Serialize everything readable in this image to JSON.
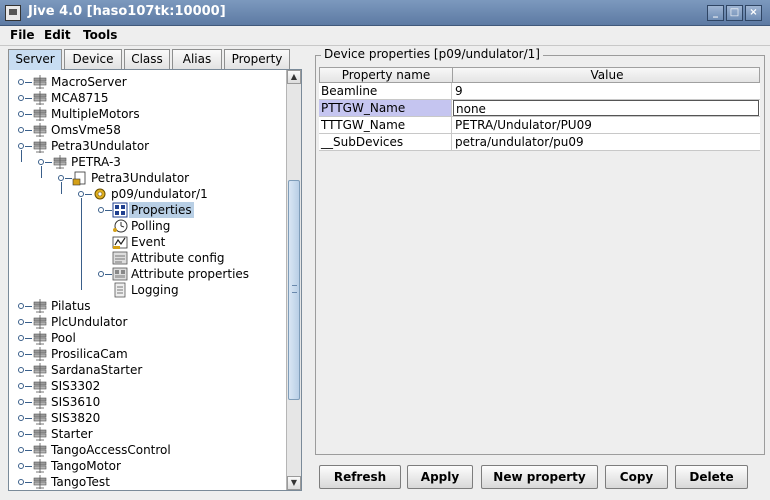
{
  "window": {
    "title": "Jive 4.0  [haso107tk:10000]"
  },
  "menu": [
    "File",
    "Edit",
    "Tools"
  ],
  "tabs": [
    "Server",
    "Device",
    "Class",
    "Alias",
    "Property"
  ],
  "active_tab": "Server",
  "tree": [
    {
      "label": "MacroServer",
      "icon": "server-icon",
      "depth": 0
    },
    {
      "label": "MCA8715",
      "icon": "server-icon",
      "depth": 0
    },
    {
      "label": "MultipleMotors",
      "icon": "server-icon",
      "depth": 0
    },
    {
      "label": "OmsVme58",
      "icon": "server-icon",
      "depth": 0
    },
    {
      "label": "Petra3Undulator",
      "icon": "server-icon",
      "depth": 0
    },
    {
      "label": "PETRA-3",
      "icon": "server-icon",
      "depth": 1
    },
    {
      "label": "Petra3Undulator",
      "icon": "class-icon",
      "depth": 2
    },
    {
      "label": "p09/undulator/1",
      "icon": "device-icon",
      "depth": 3
    },
    {
      "label": "Properties",
      "icon": "properties-icon",
      "depth": 4,
      "selected": true
    },
    {
      "label": "Polling",
      "icon": "polling-icon",
      "depth": 4
    },
    {
      "label": "Event",
      "icon": "event-icon",
      "depth": 4
    },
    {
      "label": "Attribute config",
      "icon": "attribute-config-icon",
      "depth": 4
    },
    {
      "label": "Attribute properties",
      "icon": "attribute-properties-icon",
      "depth": 4
    },
    {
      "label": "Logging",
      "icon": "logging-icon",
      "depth": 4
    },
    {
      "label": "Pilatus",
      "icon": "server-icon",
      "depth": 0
    },
    {
      "label": "PlcUndulator",
      "icon": "server-icon",
      "depth": 0
    },
    {
      "label": "Pool",
      "icon": "server-icon",
      "depth": 0
    },
    {
      "label": "ProsilicaCam",
      "icon": "server-icon",
      "depth": 0
    },
    {
      "label": "SardanaStarter",
      "icon": "server-icon",
      "depth": 0
    },
    {
      "label": "SIS3302",
      "icon": "server-icon",
      "depth": 0
    },
    {
      "label": "SIS3610",
      "icon": "server-icon",
      "depth": 0
    },
    {
      "label": "SIS3820",
      "icon": "server-icon",
      "depth": 0
    },
    {
      "label": "Starter",
      "icon": "server-icon",
      "depth": 0
    },
    {
      "label": "TangoAccessControl",
      "icon": "server-icon",
      "depth": 0
    },
    {
      "label": "TangoMotor",
      "icon": "server-icon",
      "depth": 0
    },
    {
      "label": "TangoTest",
      "icon": "server-icon",
      "depth": 0
    }
  ],
  "panel": {
    "title": "Device properties [p09/undulator/1]",
    "columns": [
      "Property name",
      "Value"
    ],
    "rows": [
      {
        "name": "Beamline",
        "value": "9"
      },
      {
        "name": "PTTGW_Name",
        "value": "none",
        "selected": true
      },
      {
        "name": "TTTGW_Name",
        "value": "PETRA/Undulator/PU09"
      },
      {
        "name": "__SubDevices",
        "value": "petra/undulator/pu09"
      }
    ]
  },
  "buttons": [
    "Refresh",
    "Apply",
    "New property",
    "Copy",
    "Delete"
  ],
  "colors": {
    "titlebar": "#6682ad",
    "selection": "#b8cfe5",
    "selected_cell": "#c5c5f0"
  }
}
